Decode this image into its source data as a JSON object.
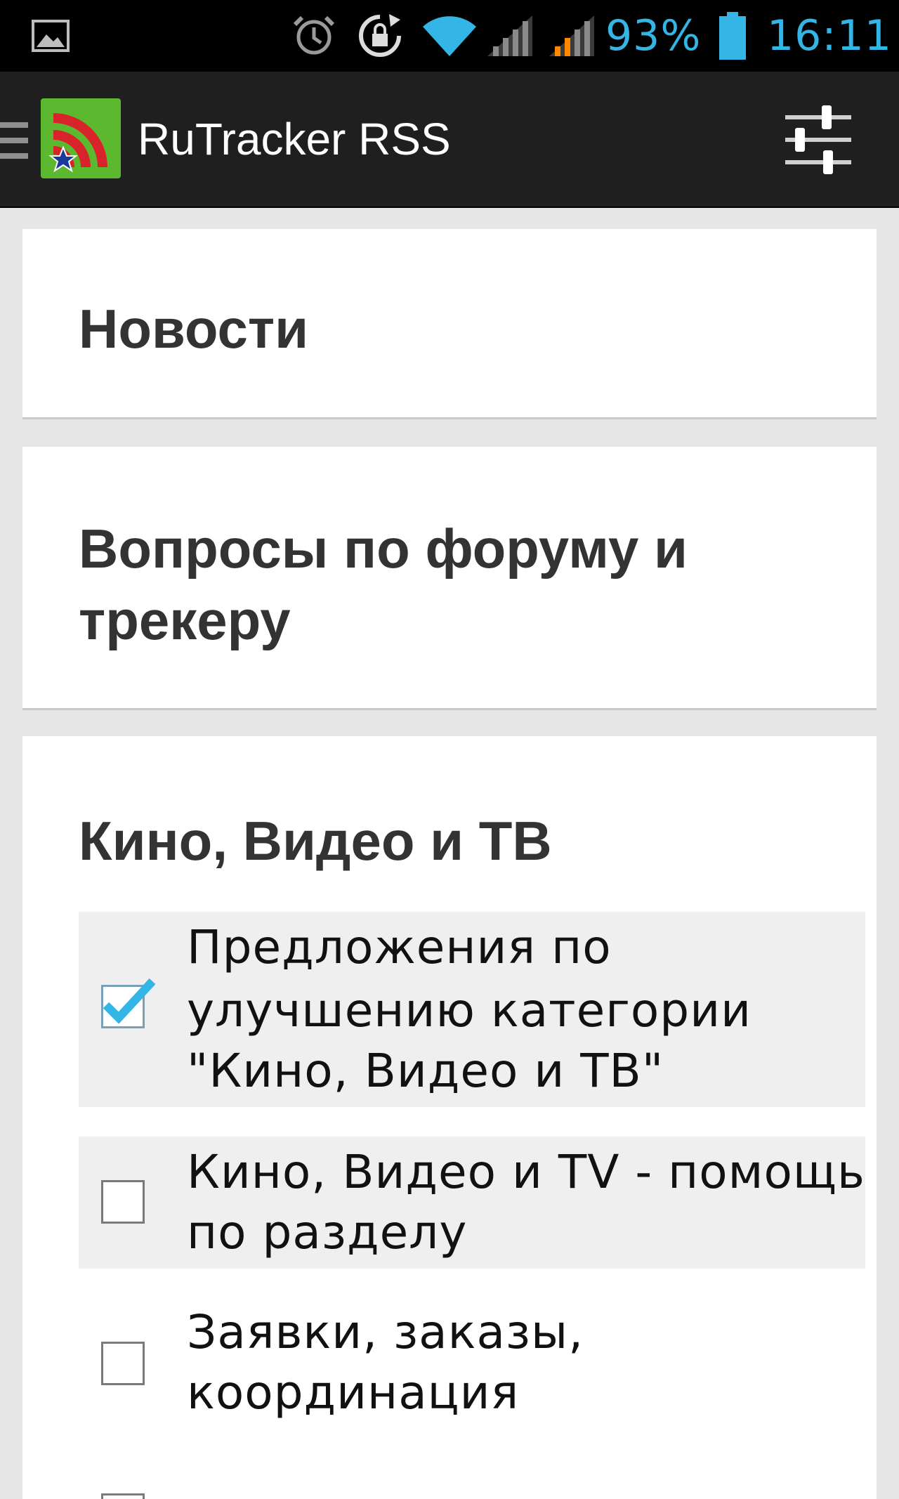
{
  "status_bar": {
    "battery_percent": "93%",
    "time": "16:11",
    "icons": [
      "image-notification-icon",
      "alarm-icon",
      "screen-rotation-lock-icon",
      "wifi-icon",
      "signal-icon",
      "signal-icon",
      "battery-icon"
    ]
  },
  "action_bar": {
    "title": "RuTracker RSS",
    "icons": [
      "drawer-menu-icon",
      "rss-app-icon",
      "settings-sliders-icon"
    ]
  },
  "sections": [
    {
      "title": "Новости"
    },
    {
      "title_line1": "Вопросы по форуму и",
      "title_line2": "трекеру"
    },
    {
      "title": "Кино, Видео и ТВ",
      "items": [
        {
          "line1": "Предложения по",
          "line2": "улучшению категории",
          "line3": "\"Кино, Видео и ТВ\"",
          "checked": true
        },
        {
          "line1": "Кино, Видео и TV - помощь",
          "line2": "по разделу",
          "checked": false
        },
        {
          "line1": "Заявки, заказы,",
          "line2": "координация",
          "checked": false
        }
      ]
    }
  ],
  "colors": {
    "accent": "#33b5e5",
    "action_bar": "#1f1f1f",
    "background": "#e6e6e6",
    "checkmark": "#33b5e5"
  }
}
